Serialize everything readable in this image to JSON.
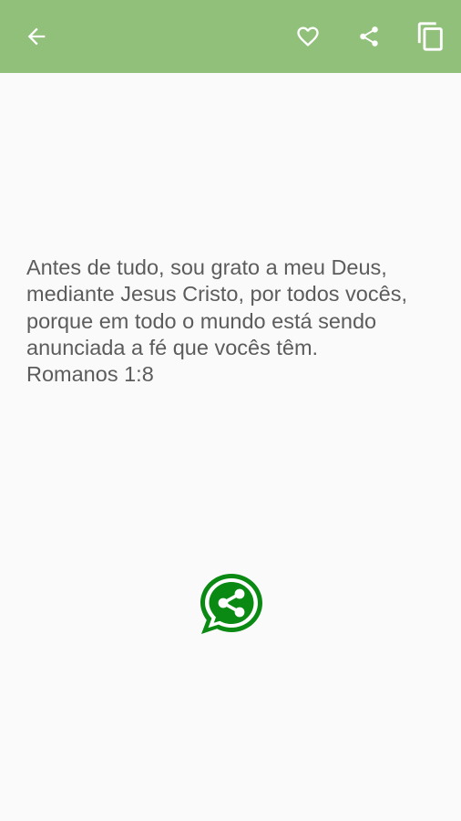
{
  "app_bar": {
    "background": "#91c07a",
    "icons": {
      "back": "arrow-left-icon",
      "favorite": "heart-outline-icon",
      "share": "share-icon",
      "copy": "copy-icon"
    }
  },
  "verse": {
    "text": "Antes de tudo, sou grato a meu Deus, mediante Jesus Cristo, por todos vocês, porque em todo o mundo está sendo anunciada a fé que vocês têm.",
    "reference": "Romanos 1:8",
    "color": "#5c5c5c"
  },
  "whatsapp_share": {
    "icon": "whatsapp-share-icon",
    "color": "#0a8a12"
  }
}
